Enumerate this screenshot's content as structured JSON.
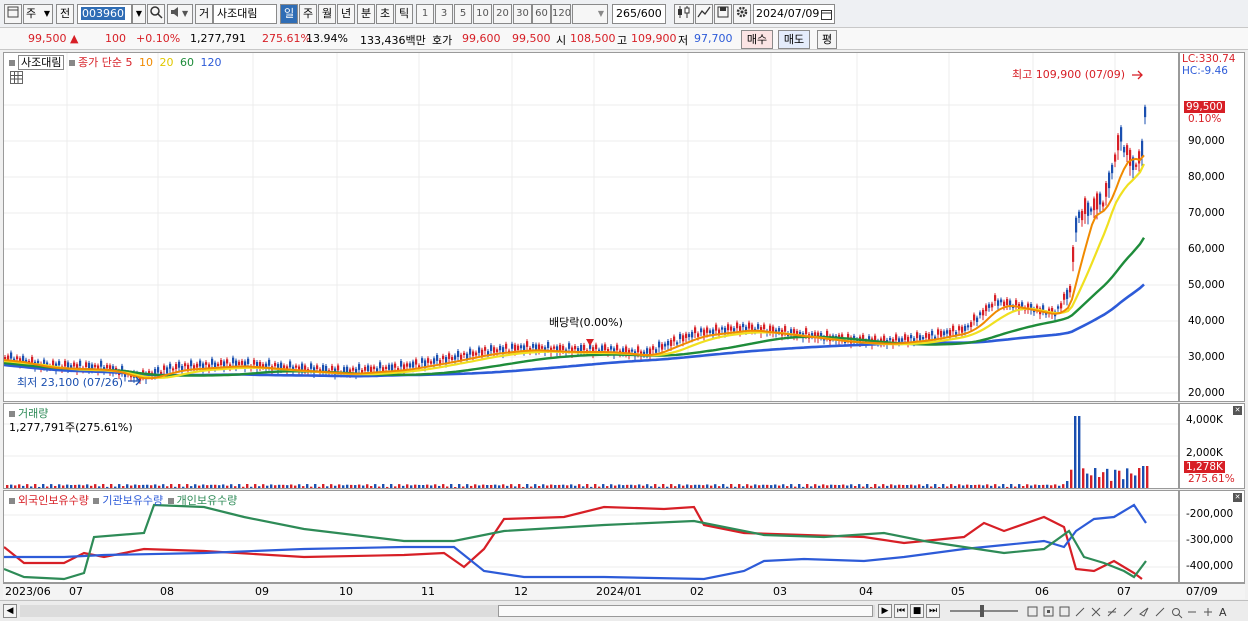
{
  "toolbar": {
    "market_label": "주",
    "prev_label": "전",
    "stock_code": "003960",
    "order_label": "거",
    "stock_name": "사조대림",
    "periods": [
      "일",
      "주",
      "월",
      "년",
      "분",
      "초",
      "틱"
    ],
    "active_period": "일",
    "intervals": [
      "1",
      "3",
      "5",
      "10",
      "20",
      "30",
      "60",
      "120"
    ],
    "count": "265",
    "count_max": "/600",
    "date": "2024/07/09"
  },
  "quote": {
    "price": "99,500",
    "change": "100",
    "change_pct": "+0.10%",
    "volume": "1,277,791",
    "volume_ratio": "275.61%",
    "turnover": "13.94%",
    "amount": "133,436백만",
    "ask_label": "호가",
    "ask1": "99,600",
    "ask2": "99,500",
    "open_label": "시",
    "open": "108,500",
    "high_label": "고",
    "high": "109,900",
    "low_label": "저",
    "low": "97,700",
    "buy_label": "매수",
    "sell_label": "매도",
    "eval_label": "평"
  },
  "price_panel": {
    "title": "사조대림",
    "ma_label": "종가 단순",
    "ma_periods": [
      "5",
      "10",
      "20",
      "60",
      "120"
    ],
    "ma_colors": [
      "#d71f26",
      "#f08a00",
      "#f0e020",
      "#1e8c3a",
      "#2d5bd8"
    ],
    "lc": "LC:330.74",
    "hc": "HC:-9.46",
    "max_annotation": "최고 109,900 (07/09)",
    "min_annotation": "최저 23,100 (07/26)",
    "dividend_annotation": "배당락(0.00%)",
    "price_tag": "99,500",
    "pct_tag": "0.10%",
    "y_ticks": [
      "90,000",
      "80,000",
      "70,000",
      "60,000",
      "50,000",
      "40,000",
      "30,000",
      "20,000"
    ]
  },
  "volume_panel": {
    "title": "거래량",
    "value_label": "1,277,791주(275.61%)",
    "y_ticks": [
      "4,000K",
      "2,000K"
    ],
    "vol_tag": "1,278K",
    "pct_tag": "275.61%"
  },
  "holding_panel": {
    "legend": [
      "외국인보유수량",
      "기관보유수량",
      "개인보유수량"
    ],
    "colors": [
      "#d71f26",
      "#2d5bd8",
      "#2e8b57"
    ],
    "y_ticks": [
      "-200,000",
      "-300,000",
      "-400,000"
    ]
  },
  "x_axis": {
    "labels": [
      "2023/06",
      "07",
      "08",
      "09",
      "10",
      "11",
      "12",
      "2024/01",
      "02",
      "03",
      "04",
      "05",
      "06",
      "07"
    ],
    "right_label": "07/09"
  },
  "icons": [
    "window-icon",
    "search-icon",
    "speaker-icon",
    "candle-icon",
    "crosshair-icon",
    "save-icon",
    "gear-icon",
    "calendar-icon"
  ]
}
